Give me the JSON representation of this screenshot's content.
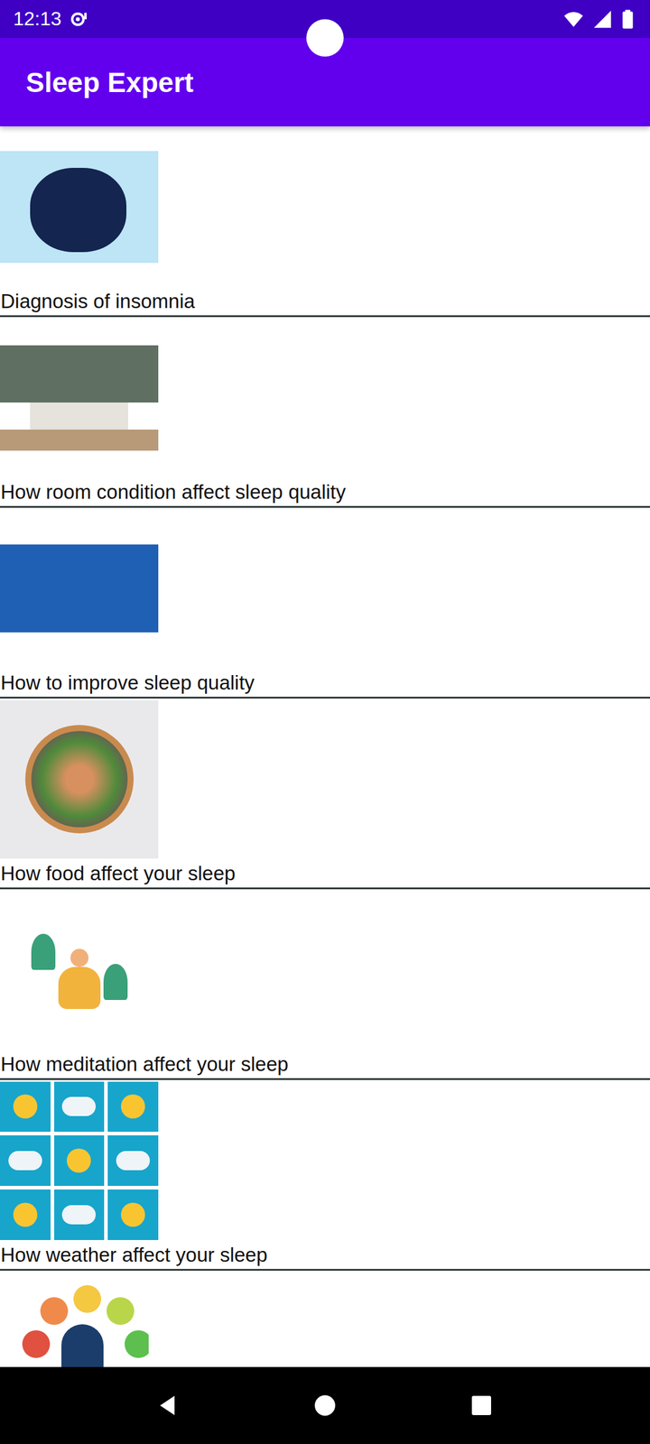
{
  "status_bar": {
    "time": "12:13"
  },
  "app_bar": {
    "title": "Sleep Expert"
  },
  "articles": [
    {
      "title": "Diagnosis of insomnia"
    },
    {
      "title": "How room condition affect sleep quality"
    },
    {
      "title": "How to improve sleep quality"
    },
    {
      "title": "How food affect your sleep"
    },
    {
      "title": "How meditation affect your sleep"
    },
    {
      "title": "How weather affect your sleep"
    },
    {
      "title": ""
    }
  ]
}
